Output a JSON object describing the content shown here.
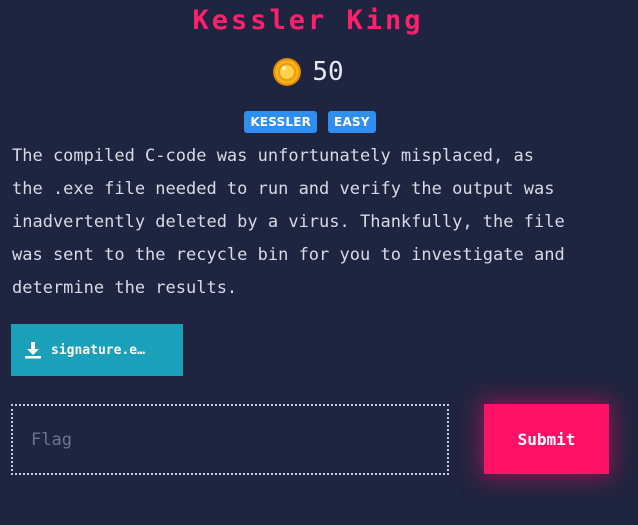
{
  "challenge": {
    "title": "Kessler King",
    "points": "50",
    "tags": [
      "KESSLER",
      "EASY"
    ],
    "description": "The compiled C-code was unfortunately misplaced, as\nthe .exe file needed to run and verify the output was\ninadvertently deleted by a virus. Thankfully, the file\nwas sent to the recycle bin for you to investigate and\ndetermine the results."
  },
  "attachment": {
    "filename": "signature.e…",
    "icon": "download-icon"
  },
  "flag_form": {
    "placeholder": "Flag",
    "value": "",
    "submit_label": "Submit"
  },
  "colors": {
    "background": "#1f2440",
    "title": "#ff1f6b",
    "tag": "#2f8ff0",
    "download_button": "#1aa0b8",
    "submit_button": "#ff1166",
    "coin": "#f5b21a"
  }
}
